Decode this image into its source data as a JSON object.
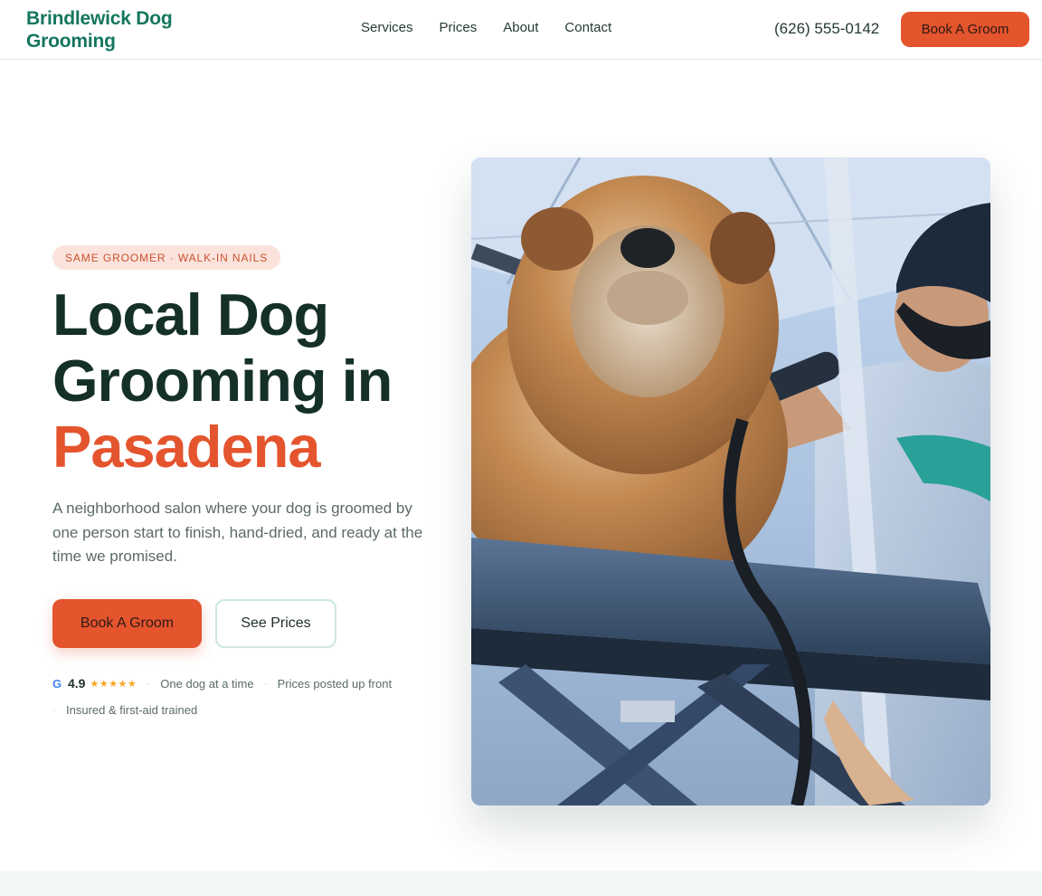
{
  "header": {
    "logo": "Brindlewick Dog Grooming",
    "nav": [
      "Services",
      "Prices",
      "About",
      "Contact"
    ],
    "phone": "(626) 555-0142",
    "cta": "Book A Groom"
  },
  "hero": {
    "pill": "SAME GROOMER · WALK-IN NAILS",
    "headline_line1": "Local Dog",
    "headline_line2": "Grooming in",
    "headline_accent": "Pasadena",
    "lede": "A neighborhood salon where your dog is groomed by one person start to finish, hand-dried, and ready at the time we promised.",
    "primary_cta": "Book A Groom",
    "secondary_cta": "See Prices",
    "rating": "4.9",
    "stars": "★★★★★",
    "trust_items": [
      "One dog at a time",
      "Prices posted up front",
      "Insured & first-aid trained"
    ]
  },
  "colors": {
    "brand_green": "#15765f",
    "accent_orange": "#e4542d",
    "heading_dark": "#143029"
  },
  "icons": {
    "google": "google-g-icon",
    "stars": "star-icon"
  }
}
